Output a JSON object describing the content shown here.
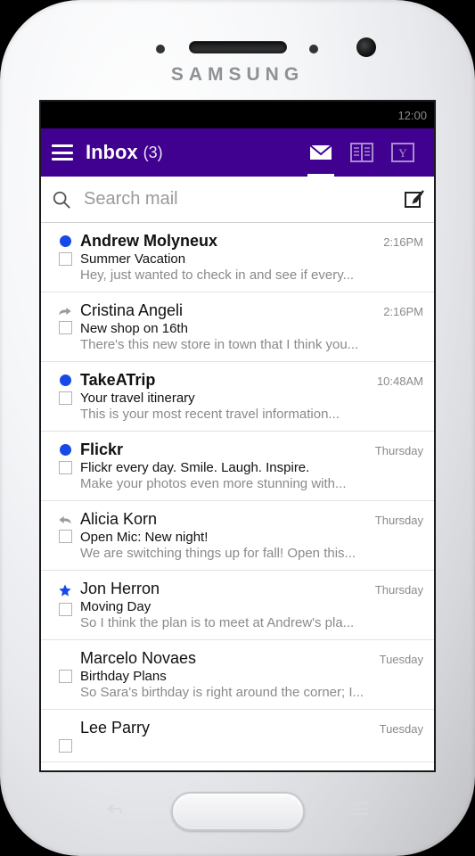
{
  "device": {
    "brand": "SAMSUNG"
  },
  "status": {
    "time": "12:00"
  },
  "header": {
    "folder": "Inbox",
    "count": "(3)"
  },
  "search": {
    "placeholder": "Search mail"
  },
  "emails": [
    {
      "indicator": "unread",
      "sender": "Andrew Molyneux",
      "bold": true,
      "subject": "Summer Vacation",
      "preview": "Hey, just wanted to check in and see if every...",
      "time": "2:16PM"
    },
    {
      "indicator": "forward",
      "sender": "Cristina Angeli",
      "bold": false,
      "subject": "New shop on 16th",
      "preview": "There's this new store in town that I think you...",
      "time": "2:16PM"
    },
    {
      "indicator": "unread",
      "sender": "TakeATrip",
      "bold": true,
      "subject": "Your travel itinerary",
      "preview": "This is your most recent travel information...",
      "time": "10:48AM"
    },
    {
      "indicator": "unread",
      "sender": "Flickr",
      "bold": true,
      "subject": "Flickr every day. Smile. Laugh. Inspire.",
      "preview": "Make your photos even more stunning with...",
      "time": "Thursday"
    },
    {
      "indicator": "reply",
      "sender": "Alicia Korn",
      "bold": false,
      "subject": "Open Mic: New night!",
      "preview": "We are switching things up for fall! Open this...",
      "time": "Thursday"
    },
    {
      "indicator": "star",
      "sender": "Jon Herron",
      "bold": false,
      "subject": "Moving Day",
      "preview": "So I think the plan is to meet at Andrew's pla...",
      "time": "Thursday"
    },
    {
      "indicator": "none",
      "sender": "Marcelo Novaes",
      "bold": false,
      "subject": "Birthday Plans",
      "preview": "So Sara's birthday is right around the corner; I...",
      "time": "Tuesday"
    },
    {
      "indicator": "none",
      "sender": "Lee Parry",
      "bold": false,
      "subject": "",
      "preview": "",
      "time": "Tuesday"
    }
  ]
}
